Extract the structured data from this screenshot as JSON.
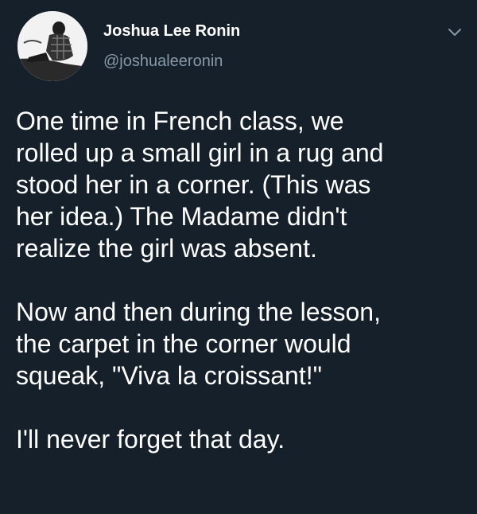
{
  "author": {
    "display_name": "Joshua Lee Ronin",
    "handle": "@joshualeeronin",
    "avatar_icon": "profile-photo",
    "more_icon": "chevron-down-icon"
  },
  "tweet": {
    "paragraphs": [
      "One time in French class, we\nrolled up a small girl in a rug and\nstood her in a corner. (This was\nher idea.) The Madame didn't\nrealize the girl was absent.",
      "Now and then during the lesson,\nthe carpet in the corner would\nsqueak, \"Viva la croissant!\"",
      "I'll never forget that day."
    ]
  },
  "colors": {
    "background": "#15202b",
    "text": "#ffffff",
    "secondary_text": "#8899a6"
  }
}
